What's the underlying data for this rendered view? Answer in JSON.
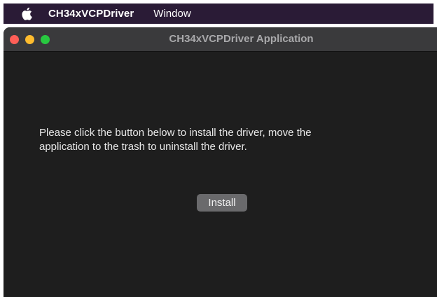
{
  "menubar": {
    "apple_icon": "apple-logo-icon",
    "app_name": "CH34xVCPDriver",
    "items": [
      "Window"
    ]
  },
  "window": {
    "title": "CH34xVCPDriver Application",
    "traffic_lights": {
      "close_color": "#ff5f57",
      "minimize_color": "#febc2e",
      "maximize_color": "#28c840"
    }
  },
  "content": {
    "message_line1": "Please click the button below to install the driver, move the",
    "message_line2": "application to the trash to uninstall the driver.",
    "install_label": "Install"
  },
  "colors": {
    "menubar_bg": "#2a1b36",
    "window_bg": "#1e1e1e",
    "titlebar_bg": "#3a3a3c",
    "button_bg": "#6a6a6c"
  }
}
